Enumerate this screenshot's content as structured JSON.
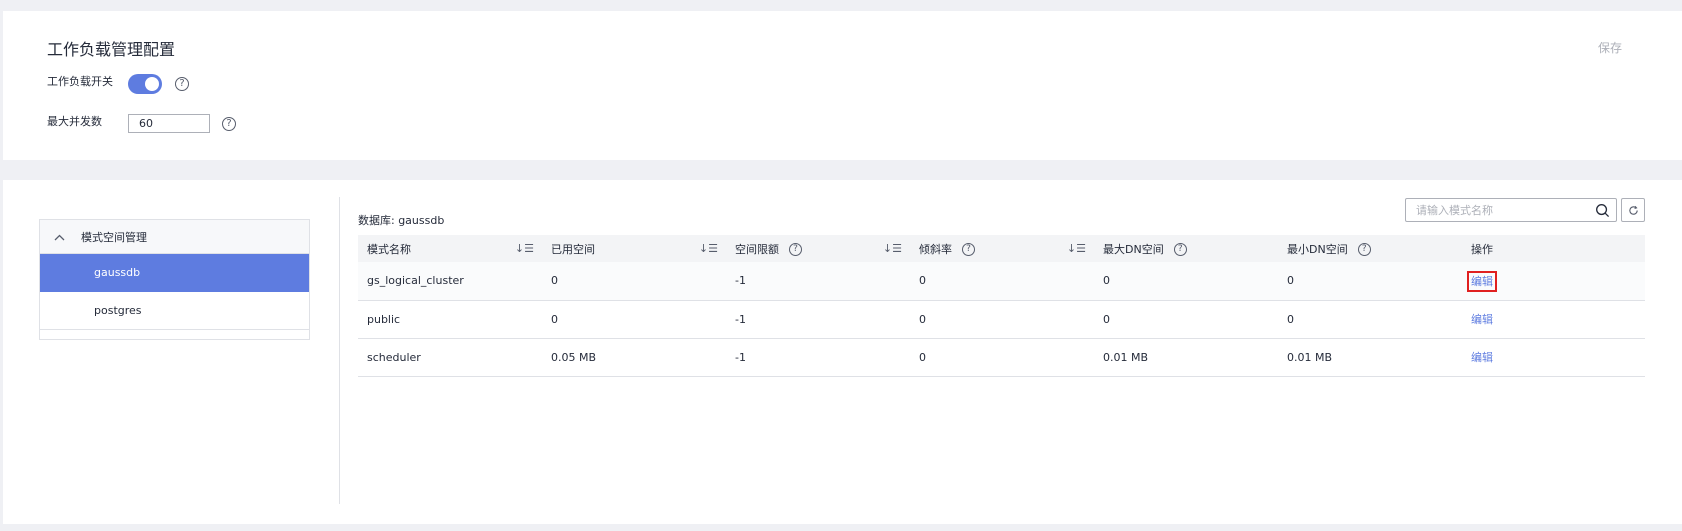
{
  "config": {
    "title": "工作负载管理配置",
    "save_label": "保存",
    "workload_switch_label": "工作负载开关",
    "workload_switch_on": true,
    "max_concurrency_label": "最大并发数",
    "max_concurrency_value": "60",
    "help_glyph": "?"
  },
  "tree": {
    "header": "模式空间管理",
    "caret": "^",
    "items": [
      {
        "label": "gaussdb",
        "active": true
      },
      {
        "label": "postgres",
        "active": false
      }
    ]
  },
  "main": {
    "database_label": "数据库: gaussdb",
    "search_placeholder": "请输入模式名称",
    "sort_glyph": "↓☰",
    "columns": [
      {
        "label": "模式名称",
        "sortable": true,
        "help": false
      },
      {
        "label": "已用空间",
        "sortable": true,
        "help": false
      },
      {
        "label": "空间限额",
        "sortable": true,
        "help": true
      },
      {
        "label": "倾斜率",
        "sortable": true,
        "help": true
      },
      {
        "label": "最大DN空间",
        "sortable": false,
        "help": true
      },
      {
        "label": "最小DN空间",
        "sortable": false,
        "help": true
      },
      {
        "label": "操作",
        "sortable": false,
        "help": false
      }
    ],
    "rows": [
      {
        "name": "gs_logical_cluster",
        "used": "0",
        "quota": "-1",
        "skew": "0",
        "max_dn": "0",
        "min_dn": "0",
        "action": "编辑"
      },
      {
        "name": "public",
        "used": "0",
        "quota": "-1",
        "skew": "0",
        "max_dn": "0",
        "min_dn": "0",
        "action": "编辑"
      },
      {
        "name": "scheduler",
        "used": "0.05 MB",
        "quota": "-1",
        "skew": "0",
        "max_dn": "0.01 MB",
        "min_dn": "0.01 MB",
        "action": "编辑"
      }
    ]
  },
  "colors": {
    "accent": "#5e7ce0",
    "highlight": "#e02020",
    "background": "#eff0f4"
  }
}
